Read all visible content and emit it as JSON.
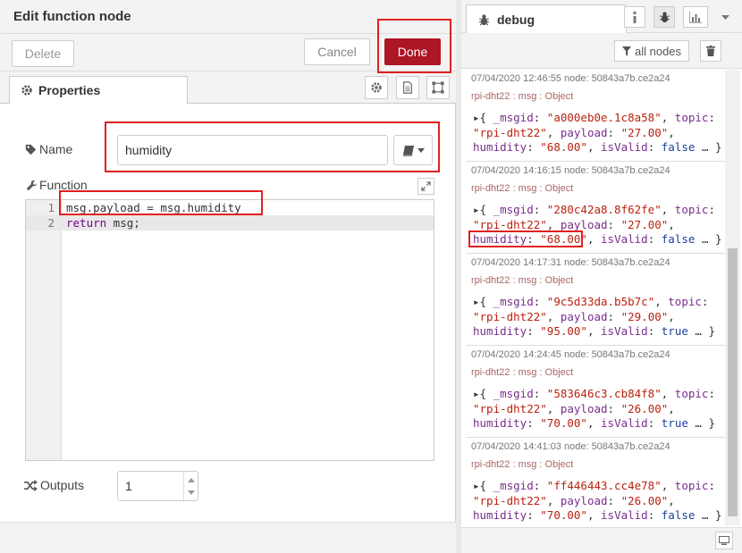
{
  "editor": {
    "title": "Edit function node",
    "delete_label": "Delete",
    "cancel_label": "Cancel",
    "done_label": "Done",
    "tab_properties": "Properties",
    "name_label": "Name",
    "name_value": "humidity",
    "function_label": "Function",
    "code_lines": [
      {
        "num": "1",
        "text": "msg.payload = msg.humidity"
      },
      {
        "num": "2",
        "kw": "return",
        "text": " msg;"
      }
    ],
    "outputs_label": "Outputs",
    "outputs_value": "1"
  },
  "debug": {
    "tab_label": "debug",
    "filter_label": "all nodes",
    "messages": [
      {
        "meta": "07/04/2020 12:46:55   node: 50843a7b.ce2a24",
        "topic": "rpi-dht22 : msg : Object",
        "msgid": "\"a000eb0e.1c8a58\"",
        "topic_val": "\"rpi-dht22\"",
        "payload": "\"27.00\"",
        "humidity": "\"68.00\"",
        "isValid": "false"
      },
      {
        "meta": "07/04/2020 14:16:15   node: 50843a7b.ce2a24",
        "topic": "rpi-dht22 : msg : Object",
        "msgid": "\"280c42a8.8f62fe\"",
        "topic_val": "\"rpi-dht22\"",
        "payload": "\"27.00\"",
        "humidity": "\"68.00\"",
        "isValid": "false"
      },
      {
        "meta": "07/04/2020 14:17:31   node: 50843a7b.ce2a24",
        "topic": "rpi-dht22 : msg : Object",
        "msgid": "\"9c5d33da.b5b7c\"",
        "topic_val": "\"rpi-dht22\"",
        "payload": "\"29.00\"",
        "humidity": "\"95.00\"",
        "isValid": "true"
      },
      {
        "meta": "07/04/2020 14:24:45   node: 50843a7b.ce2a24",
        "topic": "rpi-dht22 : msg : Object",
        "msgid": "\"583646c3.cb84f8\"",
        "topic_val": "\"rpi-dht22\"",
        "payload": "\"26.00\"",
        "humidity": "\"70.00\"",
        "isValid": "true"
      },
      {
        "meta": "07/04/2020 14:41:03   node: 50843a7b.ce2a24",
        "topic": "rpi-dht22 : msg : Object",
        "msgid": "\"ff446443.cc4e78\"",
        "topic_val": "\"rpi-dht22\"",
        "payload": "\"26.00\"",
        "humidity": "\"70.00\"",
        "isValid": "false"
      }
    ]
  },
  "colors": {
    "done_button": "#ad1625",
    "highlight_box": "#e02020"
  }
}
